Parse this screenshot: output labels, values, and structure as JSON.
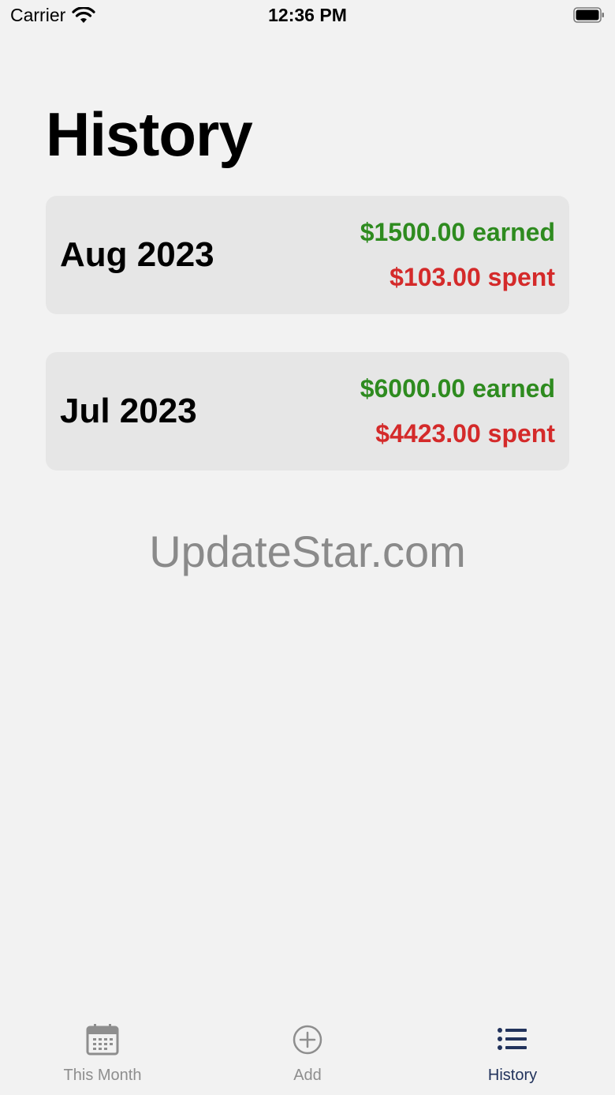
{
  "status_bar": {
    "carrier": "Carrier",
    "time": "12:36 PM"
  },
  "page": {
    "title": "History"
  },
  "history": [
    {
      "month": "Aug 2023",
      "earned": "$1500.00 earned",
      "spent": "$103.00 spent"
    },
    {
      "month": "Jul 2023",
      "earned": "$6000.00 earned",
      "spent": "$4423.00 spent"
    }
  ],
  "watermark": "UpdateStar.com",
  "tabs": [
    {
      "label": "This Month",
      "icon": "calendar-icon"
    },
    {
      "label": "Add",
      "icon": "plus-circle-icon"
    },
    {
      "label": "History",
      "icon": "list-icon"
    }
  ],
  "colors": {
    "earned": "#2e8b1f",
    "spent": "#d42a2a",
    "active_tab": "#22335c",
    "inactive_tab": "#8e8e8e",
    "card_bg": "#e6e6e6",
    "page_bg": "#f2f2f2"
  }
}
